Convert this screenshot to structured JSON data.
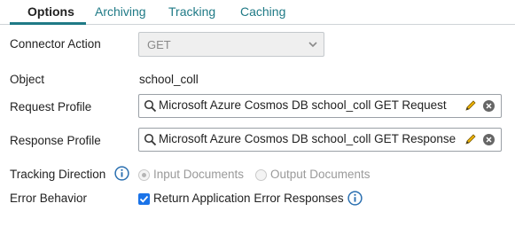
{
  "tabs": [
    {
      "label": "Options",
      "active": true
    },
    {
      "label": "Archiving",
      "active": false
    },
    {
      "label": "Tracking",
      "active": false
    },
    {
      "label": "Caching",
      "active": false
    }
  ],
  "colors": {
    "accent": "#1f7a86",
    "checkbox": "#1a73e8",
    "info": "#2a6fb0"
  },
  "connector_action": {
    "label": "Connector Action",
    "value": "GET",
    "disabled": true
  },
  "object": {
    "label": "Object",
    "value": "school_coll"
  },
  "request_profile": {
    "label": "Request Profile",
    "value": "Microsoft Azure Cosmos DB school_coll GET Request"
  },
  "response_profile": {
    "label": "Response Profile",
    "value": "Microsoft Azure Cosmos DB school_coll GET Response"
  },
  "tracking_direction": {
    "label": "Tracking Direction",
    "options": [
      {
        "label": "Input Documents",
        "selected": true,
        "disabled": true
      },
      {
        "label": "Output Documents",
        "selected": false,
        "disabled": true
      }
    ]
  },
  "error_behavior": {
    "label": "Error Behavior",
    "checkbox_label": "Return Application Error Responses",
    "checked": true
  }
}
